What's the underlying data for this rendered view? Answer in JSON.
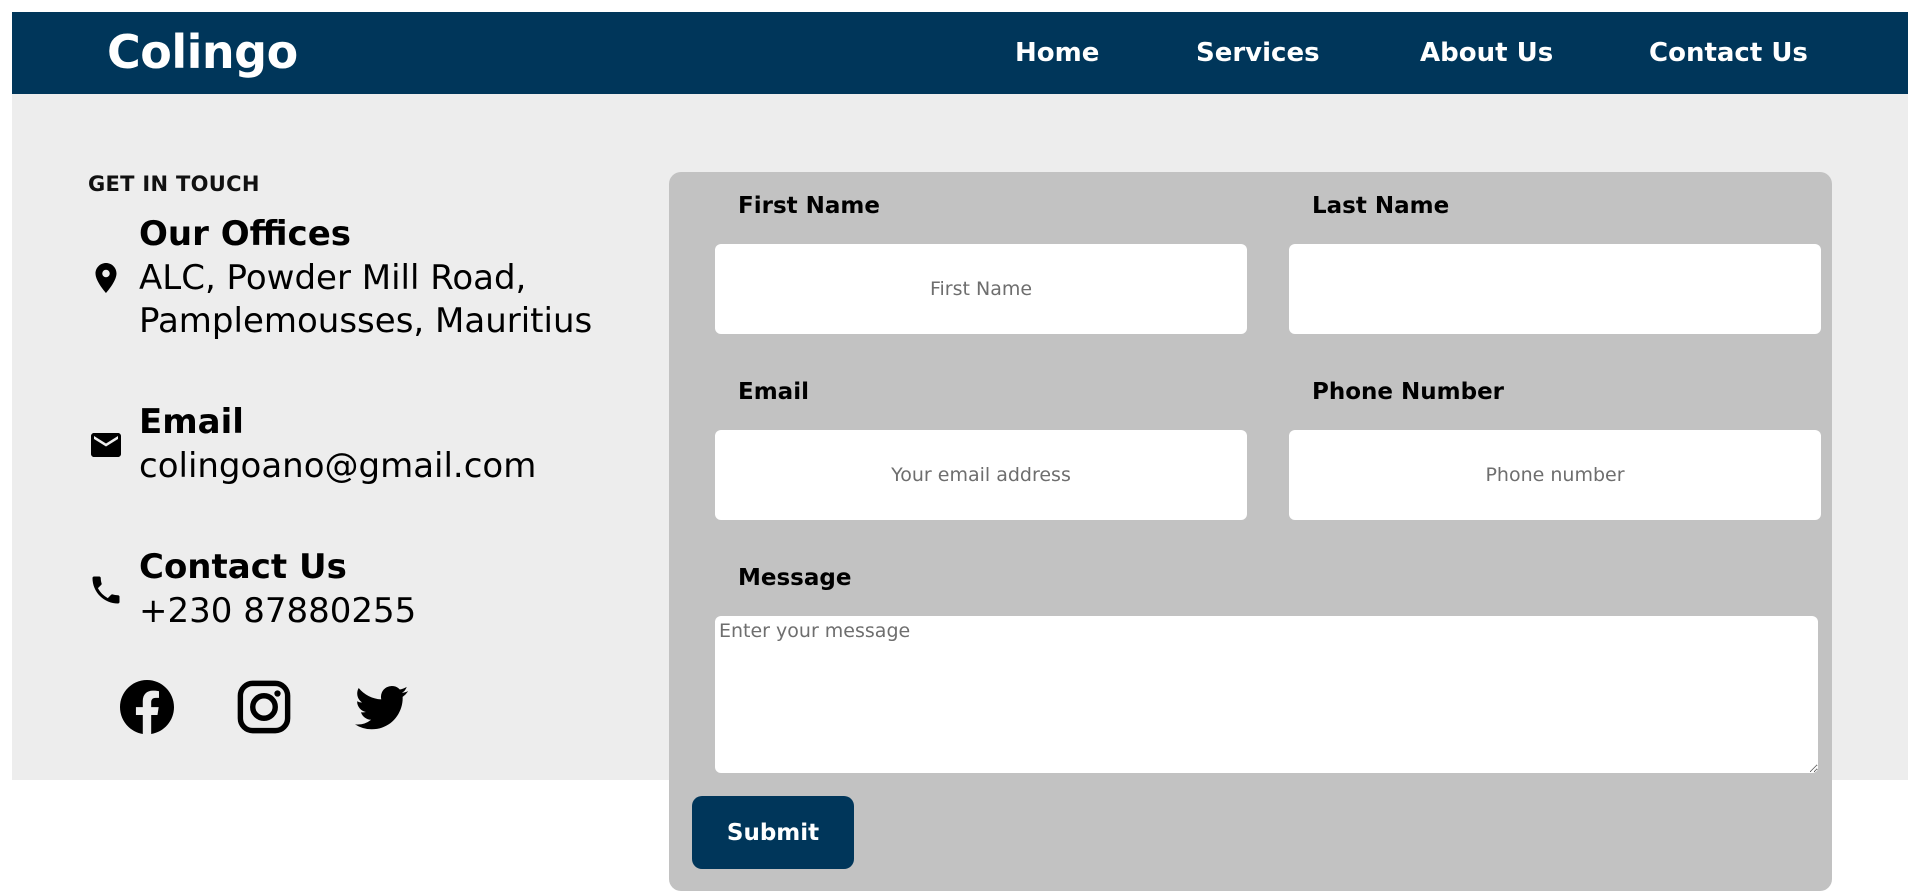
{
  "brand": "Colingo",
  "nav": {
    "home": "Home",
    "services": "Services",
    "about": "About Us",
    "contact": "Contact Us"
  },
  "info": {
    "eyebrow": "GET IN TOUCH",
    "offices": {
      "title": "Our Offices",
      "line1": "ALC, Powder Mill Road,",
      "line2": "Pamplemousses, Mauritius",
      "icon": "location-pin-icon"
    },
    "email": {
      "title": "Email",
      "value": "colingoano@gmail.com",
      "icon": "mail-icon"
    },
    "phone": {
      "title": "Contact Us",
      "value": "+230 87880255",
      "icon": "phone-icon"
    },
    "social": [
      "facebook-icon",
      "instagram-icon",
      "twitter-icon"
    ]
  },
  "form": {
    "first_name_label": "First Name",
    "first_name_placeholder": "First Name",
    "last_name_label": "Last Name",
    "last_name_placeholder": "",
    "email_label": "Email",
    "email_placeholder": "Your email address",
    "phone_label": "Phone Number",
    "phone_placeholder": "Phone number",
    "message_label": "Message",
    "message_placeholder": "Enter your message",
    "submit_label": "Submit"
  },
  "colors": {
    "navbar": "#00365a",
    "section_background": "#ededed",
    "form_background": "#c2c2c2",
    "button": "#00365a"
  }
}
